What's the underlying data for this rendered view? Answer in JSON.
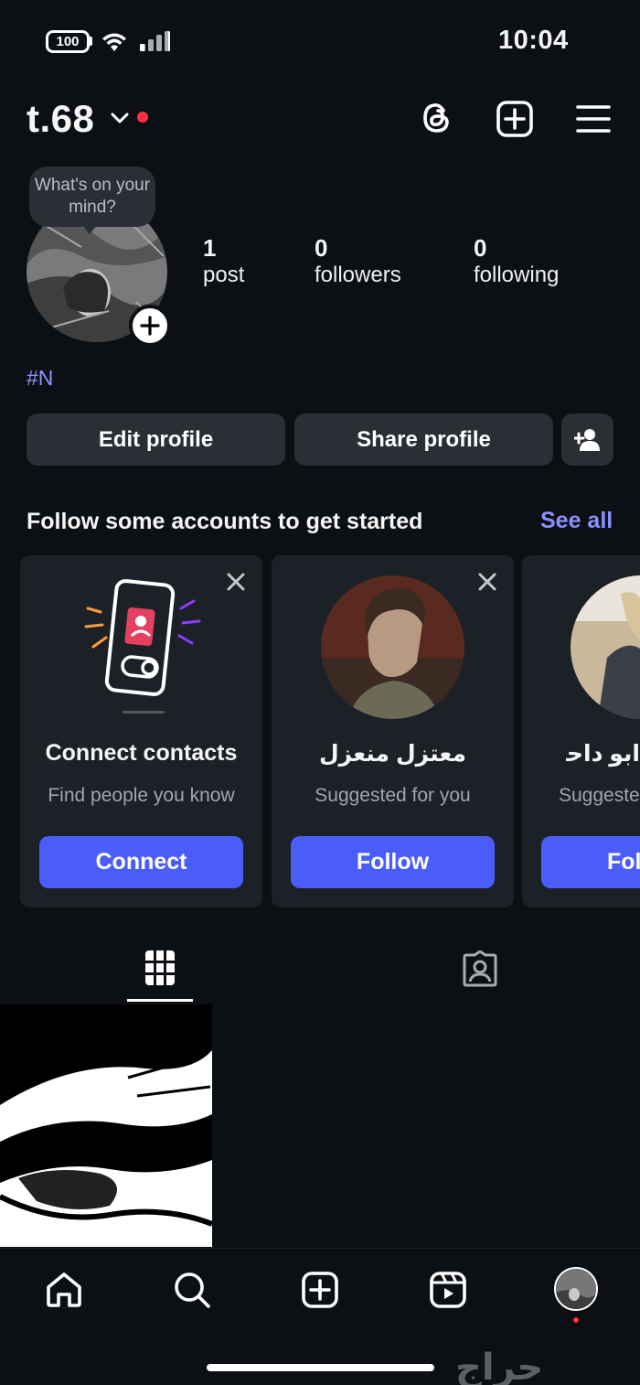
{
  "status_bar": {
    "time": "10:04",
    "battery": "100"
  },
  "header": {
    "username": "t.68",
    "icons": [
      "chevron-down-icon",
      "threads-icon",
      "create-icon",
      "menu-icon"
    ]
  },
  "profile": {
    "note": "What's on your mind?",
    "stats": [
      {
        "value": "1",
        "label": "post"
      },
      {
        "value": "0",
        "label": "followers"
      },
      {
        "value": "0",
        "label": "following"
      }
    ],
    "bio": "#N",
    "buttons": {
      "edit": "Edit profile",
      "share": "Share profile"
    }
  },
  "suggestions": {
    "title": "Follow some accounts to get started",
    "see_all": "See all",
    "cards": [
      {
        "title": "Connect contacts",
        "subtitle": "Find people you know",
        "button": "Connect"
      },
      {
        "title": "معتزل منعزل",
        "subtitle": "Suggested for you",
        "button": "Follow"
      },
      {
        "title": "ابو داحم",
        "subtitle": "Suggested for you",
        "button": "Follow"
      }
    ]
  },
  "tabs": [
    "grid-icon",
    "tagged-icon"
  ],
  "bottom_nav": [
    "home-icon",
    "search-icon",
    "create-icon",
    "reels-icon",
    "profile-avatar"
  ],
  "watermark": "حراج",
  "colors": {
    "background": "#0c1014",
    "accent": "#4a5df9",
    "link": "#8a8fff",
    "notification": "#ff3040"
  }
}
